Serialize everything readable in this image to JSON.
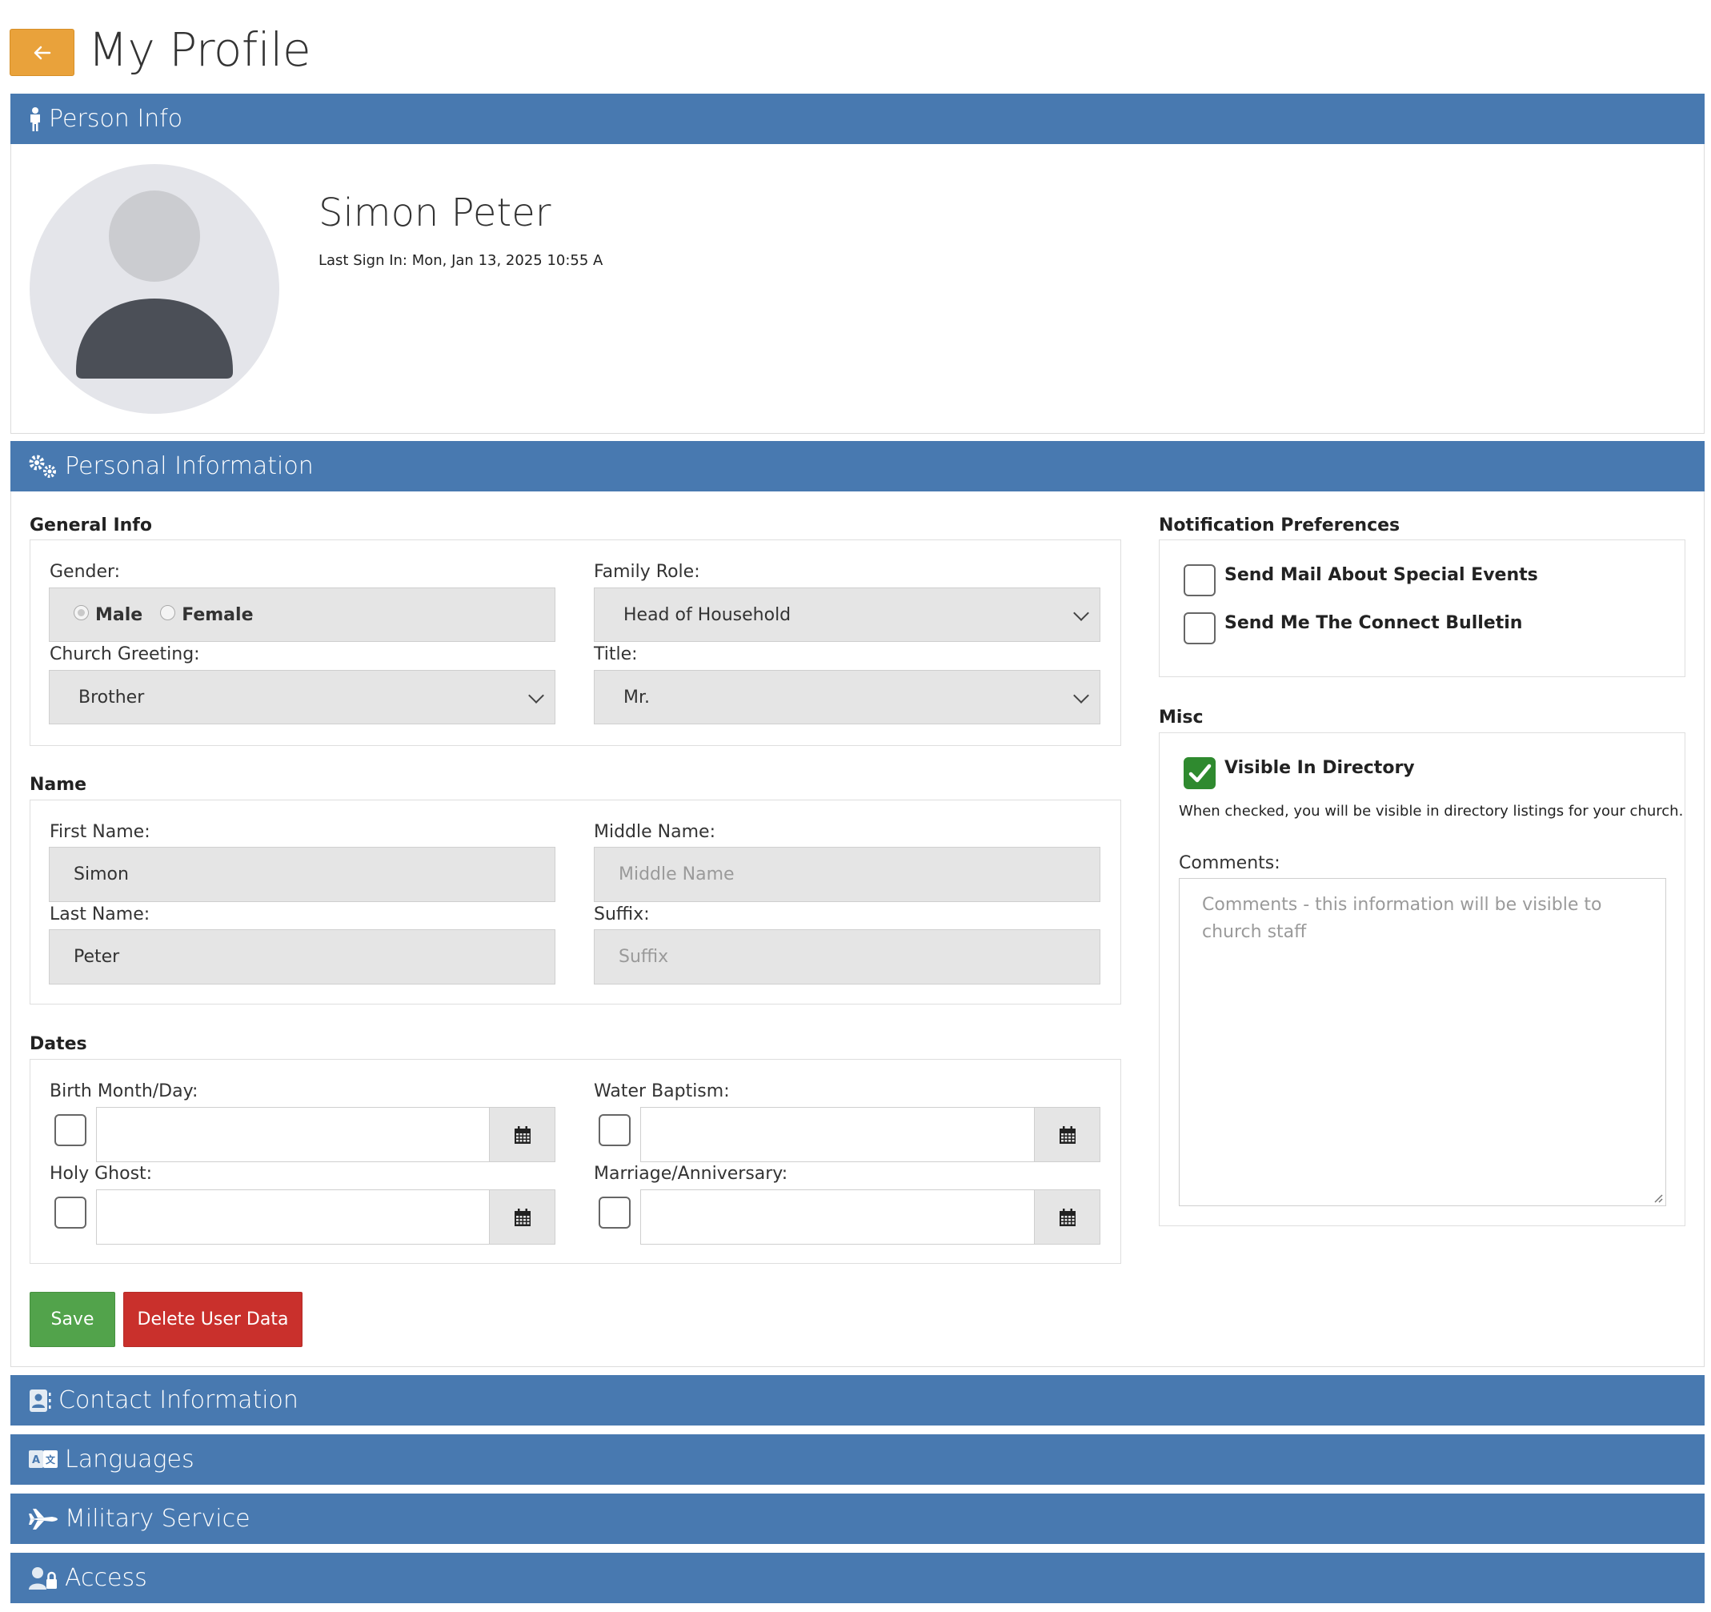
{
  "header": {
    "back_icon": "arrow-left-icon",
    "title": "My Profile"
  },
  "colors": {
    "bar": "#4879b0",
    "back_button": "#e9a23b",
    "save_button": "#52a34b",
    "delete_button": "#c9302c",
    "checkbox_checked": "#2f8a2f"
  },
  "sections": {
    "person_info": {
      "icon": "person-icon",
      "label": "Person Info"
    },
    "personal_information": {
      "icon": "gears-icon",
      "label": "Personal Information"
    },
    "contact_information": {
      "icon": "contact-card-icon",
      "label": "Contact Information"
    },
    "languages": {
      "icon": "language-icon",
      "label": "Languages"
    },
    "military_service": {
      "icon": "jet-icon",
      "label": "Military Service"
    },
    "access": {
      "icon": "user-lock-icon",
      "label": "Access"
    }
  },
  "person": {
    "name": "Simon Peter",
    "last_sign_in": "Last Sign In: Mon, Jan 13, 2025 10:55 A"
  },
  "general_info": {
    "heading": "General Info",
    "gender_label": "Gender:",
    "gender_options": [
      "Male",
      "Female"
    ],
    "family_role_label": "Family Role:",
    "family_role_value": "Head of Household",
    "church_greeting_label": "Church Greeting:",
    "church_greeting_value": "Brother",
    "title_label": "Title:",
    "title_value": "Mr."
  },
  "name": {
    "heading": "Name",
    "first_label": "First Name:",
    "first_value": "Simon",
    "middle_label": "Middle Name:",
    "middle_placeholder": "Middle Name",
    "last_label": "Last Name:",
    "last_value": "Peter",
    "suffix_label": "Suffix:",
    "suffix_placeholder": "Suffix"
  },
  "dates": {
    "heading": "Dates",
    "birth_label": "Birth Month/Day:",
    "water_label": "Water Baptism:",
    "holy_label": "Holy Ghost:",
    "marriage_label": "Marriage/Anniversary:",
    "calendar_icon": "calendar-icon"
  },
  "notifications": {
    "heading": "Notification Preferences",
    "special_events": "Send Mail About Special Events",
    "connect_bulletin": "Send Me The Connect Bulletin"
  },
  "misc": {
    "heading": "Misc",
    "visible_label": "Visible In Directory",
    "visible_checked": true,
    "visible_help": "When checked, you will be visible in directory listings for your church.",
    "comments_label": "Comments:",
    "comments_placeholder": "Comments - this information will be visible to church staff"
  },
  "actions": {
    "save": "Save",
    "delete": "Delete User Data"
  }
}
